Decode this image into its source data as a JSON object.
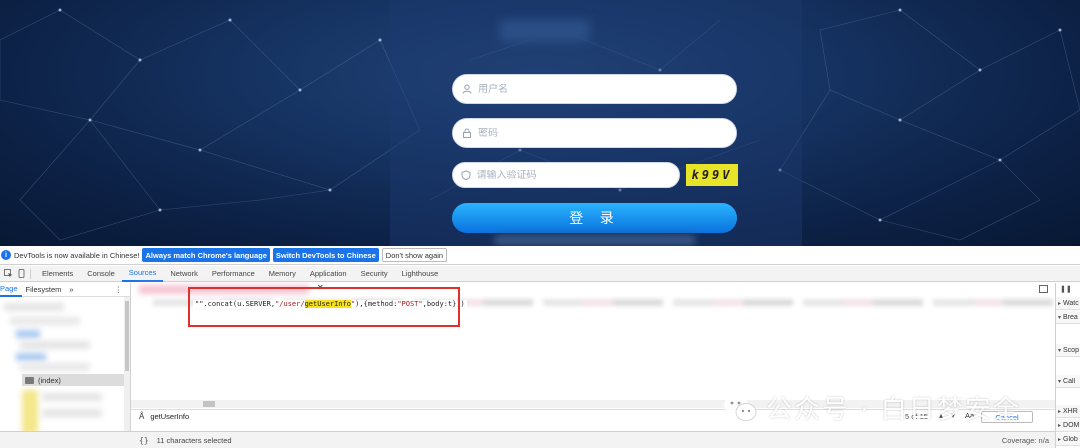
{
  "login": {
    "username_placeholder": "用户名",
    "password_placeholder": "密码",
    "captcha_placeholder": "请输入验证码",
    "captcha_text": "k99V",
    "login_button": "登 录"
  },
  "devtools": {
    "infobar": {
      "message": "DevTools is now available in Chinese!",
      "match_language": "Always match Chrome's language",
      "switch_chinese": "Switch DevTools to Chinese",
      "dont_show": "Don't show again"
    },
    "tabs": [
      "Elements",
      "Console",
      "Sources",
      "Network",
      "Performance",
      "Memory",
      "Application",
      "Security",
      "Lighthouse"
    ],
    "active_tab": "Sources",
    "navigator": {
      "tabs": [
        "Page",
        "Filesystem"
      ],
      "more": "»",
      "selected_item": "(index)"
    },
    "code": {
      "prefix": "\"\".concat(u.SERVER,",
      "string_start": "\"/user/",
      "highlight": "getUserInfo",
      "string_end": "\"",
      "suffix": "),{method:",
      "method": "\"POST\"",
      "tail": ",body:t}))"
    },
    "search": {
      "query": "getUserInfo",
      "match_count": "5 of 15",
      "aa": "Aa",
      "cancel": "Cancel"
    },
    "status": {
      "selection": "11 characters selected",
      "coverage": "Coverage: n/a"
    },
    "debugger": {
      "sections": [
        "Watch",
        "Breakpoints",
        "Scope",
        "Call Stack",
        "XHR/fetch Breakpoints",
        "DOM Breakpoints",
        "Global Listeners"
      ],
      "visible": [
        "Watc",
        "Brea",
        "Scop",
        "Call",
        "XHR",
        "DOM",
        "Glob"
      ]
    }
  },
  "watermark": {
    "text": "公众号 · 白日梦安全"
  },
  "colors": {
    "accent": "#1a73e8",
    "highlight": "#f8e21c",
    "annotation": "#e0302b",
    "captcha_bg": "#e8e42a"
  }
}
